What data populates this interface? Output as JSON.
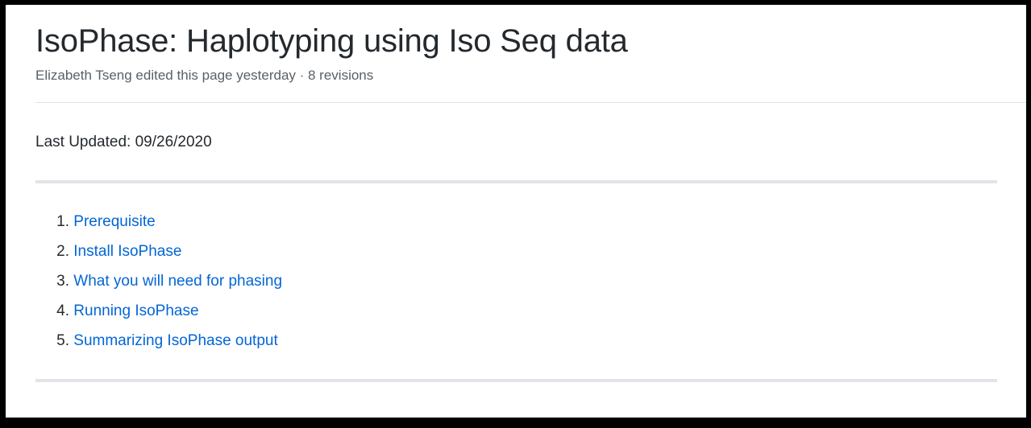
{
  "page": {
    "title": "IsoPhase: Haplotyping using Iso Seq data",
    "meta": "Elizabeth Tseng edited this page yesterday · 8 revisions"
  },
  "body": {
    "last_updated": "Last Updated: 09/26/2020",
    "toc": [
      {
        "number": "1.",
        "label": "Prerequisite"
      },
      {
        "number": "2.",
        "label": "Install IsoPhase"
      },
      {
        "number": "3.",
        "label": "What you will need for phasing"
      },
      {
        "number": "4.",
        "label": "Running IsoPhase"
      },
      {
        "number": "5.",
        "label": "Summarizing IsoPhase output"
      }
    ]
  },
  "colors": {
    "link": "#0366d6",
    "text": "#24292e",
    "muted": "#586069",
    "rule": "#e1e4e8"
  }
}
